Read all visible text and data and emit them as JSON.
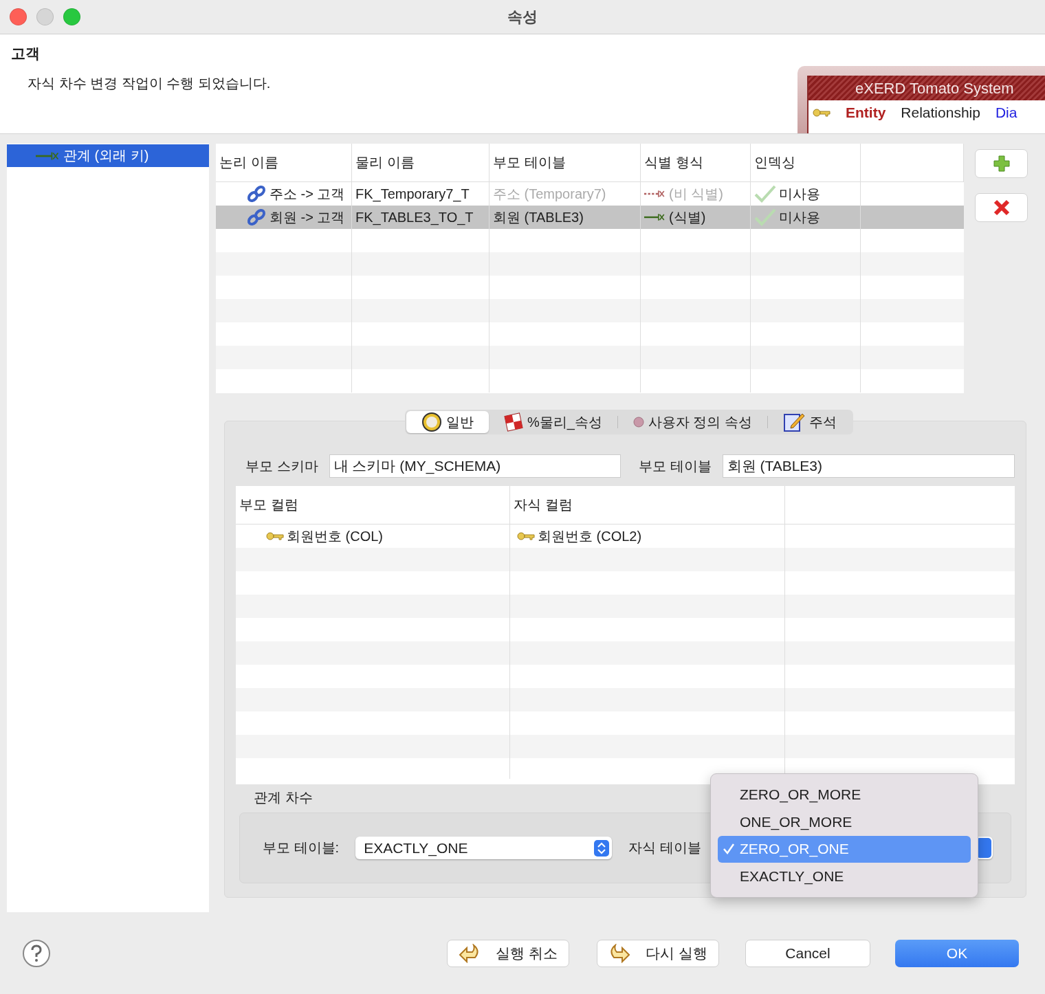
{
  "window": {
    "title": "속성"
  },
  "header": {
    "title": "고객",
    "message": "자식 차수 변경 작업이 수행 되었습니다.",
    "banner": {
      "title": "eXERD  Tomato System",
      "tabs": [
        {
          "label": "Entity",
          "color": "#b02020"
        },
        {
          "label": "Relationship",
          "color": "#222222"
        },
        {
          "label": "Dia",
          "color": "#2020e0"
        }
      ]
    }
  },
  "sidebar": {
    "items": [
      {
        "label": "관계 (외래 키)",
        "selected": true
      }
    ]
  },
  "relations": {
    "columns": [
      "논리 이름",
      "물리 이름",
      "부모 테이블",
      "식별 형식",
      "인덱싱"
    ],
    "rows": [
      {
        "logical": "주소 -> 고객",
        "physical": "FK_Temporary7_T",
        "parent": "주소 (Temporary7)",
        "identification": "(비 식별)",
        "identifying": false,
        "indexing": "미사용",
        "selected": false
      },
      {
        "logical": "회원 -> 고객",
        "physical": "FK_TABLE3_TO_T",
        "parent": "회원 (TABLE3)",
        "identification": "(식별)",
        "identifying": true,
        "indexing": "미사용",
        "selected": true
      }
    ]
  },
  "tabs": [
    {
      "label": "일반",
      "kind": "general",
      "selected": true
    },
    {
      "label": "%물리_속성",
      "kind": "physical",
      "selected": false
    },
    {
      "label": "사용자 정의 속성",
      "kind": "custom",
      "selected": false
    },
    {
      "label": "주석",
      "kind": "comment",
      "selected": false
    }
  ],
  "general": {
    "parent_schema_label": "부모 스키마",
    "parent_schema": "내 스키마 (MY_SCHEMA)",
    "parent_table_label": "부모 테이블",
    "parent_table": "회원 (TABLE3)",
    "columns": [
      "부모 컬럼",
      "자식 컬럼"
    ],
    "rows": [
      {
        "parent": "회원번호 (COL)",
        "child": "회원번호 (COL2)"
      }
    ],
    "cardinality": {
      "title": "관계 차수",
      "parent_label": "부모 테이블:",
      "parent_value": "EXACTLY_ONE",
      "child_label": "자식 테이블",
      "menu": [
        {
          "label": "ZERO_OR_MORE",
          "selected": false
        },
        {
          "label": "ONE_OR_MORE",
          "selected": false
        },
        {
          "label": "ZERO_OR_ONE",
          "selected": true
        },
        {
          "label": "EXACTLY_ONE",
          "selected": false
        }
      ]
    }
  },
  "buttons": [
    {
      "label": "실행 취소",
      "kind": "undo"
    },
    {
      "label": "다시 실행",
      "kind": "redo"
    },
    {
      "label": "Cancel",
      "kind": "plain"
    },
    {
      "label": "OK",
      "kind": "primary"
    }
  ]
}
